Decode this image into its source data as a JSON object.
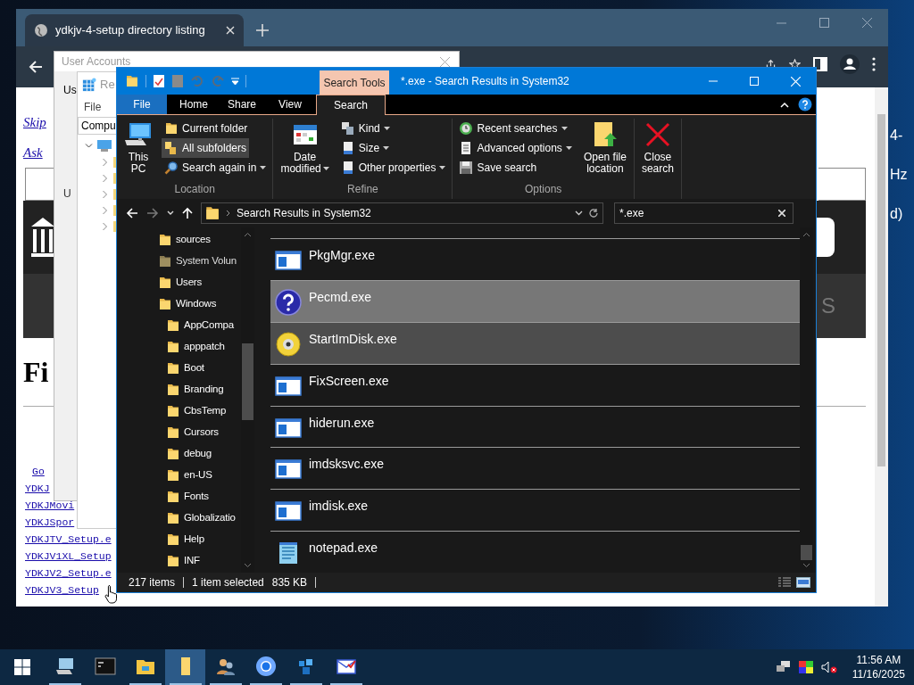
{
  "browser": {
    "tab_title": "ydkjv-4-setup directory listing",
    "page": {
      "skip_link": "Skip",
      "ask_link": "Ask",
      "banner_text": "S",
      "heading": "Fi",
      "links": [
        "Go",
        "YDKJ",
        "YDKJMovi",
        "YDKJSpor",
        "YDKJTV_Setup.e",
        "YDKJV1XL_Setup",
        "YDKJV2_Setup.e",
        "YDKJV3_Setup"
      ]
    }
  },
  "desktop_fragments": [
    "4-",
    "Hz",
    "d)"
  ],
  "user_accounts": {
    "title": "User Accounts",
    "tab": "Us",
    "label": "U"
  },
  "regedit": {
    "title": "Re",
    "menu": "File",
    "address": "Compu"
  },
  "explorer": {
    "contextual_tab": "Search Tools",
    "title": "*.exe - Search Results in System32",
    "tabs": [
      {
        "label": "File",
        "kind": "file",
        "selected": false
      },
      {
        "label": "Home",
        "kind": "tab",
        "selected": false
      },
      {
        "label": "Share",
        "kind": "tab",
        "selected": false
      },
      {
        "label": "View",
        "kind": "tab",
        "selected": false
      },
      {
        "label": "Search",
        "kind": "tab",
        "selected": true
      }
    ],
    "ribbon": [
      {
        "label": "Location",
        "items": [
          {
            "label": "This\nPC",
            "kind": "large",
            "dropdown": false,
            "selected": false
          },
          {
            "label": "Current folder",
            "kind": "small",
            "dropdown": false,
            "selected": false
          },
          {
            "label": "All subfolders",
            "kind": "small",
            "dropdown": false,
            "selected": true
          },
          {
            "label": "Search again in",
            "kind": "small",
            "dropdown": true,
            "selected": false
          }
        ]
      },
      {
        "label": "Refine",
        "items": [
          {
            "label": "Date\nmodified",
            "kind": "large",
            "dropdown": true,
            "selected": false
          },
          {
            "label": "Kind",
            "kind": "small",
            "dropdown": true,
            "selected": false
          },
          {
            "label": "Size",
            "kind": "small",
            "dropdown": true,
            "selected": false
          },
          {
            "label": "Other properties",
            "kind": "small",
            "dropdown": true,
            "selected": false
          }
        ]
      },
      {
        "label": "Options",
        "items": [
          {
            "label": "Recent searches",
            "kind": "small",
            "dropdown": true,
            "selected": false
          },
          {
            "label": "Advanced options",
            "kind": "small",
            "dropdown": true,
            "selected": false
          },
          {
            "label": "Save search",
            "kind": "small",
            "dropdown": false,
            "selected": false
          },
          {
            "label": "Open file\nlocation",
            "kind": "large",
            "dropdown": false,
            "selected": false
          }
        ]
      },
      {
        "items": [
          {
            "label": "Close\nsearch",
            "kind": "large",
            "dropdown": false,
            "selected": false
          }
        ]
      }
    ],
    "address": "Search Results in System32",
    "search": "*.exe",
    "nav": [
      {
        "label": "sources",
        "dimmed": false
      },
      {
        "label": "System Volun",
        "dimmed": true
      },
      {
        "label": "Users",
        "dimmed": false
      },
      {
        "label": "Windows",
        "dimmed": false,
        "children": [
          {
            "label": "AppCompa",
            "dimmed": false
          },
          {
            "label": "apppatch",
            "dimmed": false
          },
          {
            "label": "Boot",
            "dimmed": false
          },
          {
            "label": "Branding",
            "dimmed": false
          },
          {
            "label": "CbsTemp",
            "dimmed": false
          },
          {
            "label": "Cursors",
            "dimmed": false
          },
          {
            "label": "debug",
            "dimmed": false
          },
          {
            "label": "en-US",
            "dimmed": false
          },
          {
            "label": "Fonts",
            "dimmed": false
          },
          {
            "label": "Globalizatio",
            "dimmed": false
          },
          {
            "label": "Help",
            "dimmed": false
          },
          {
            "label": "INF",
            "dimmed": false
          }
        ]
      }
    ],
    "files": [
      {
        "name": "PkgMgr.exe",
        "kind": "app",
        "selected": false,
        "hovered": false
      },
      {
        "name": "Pecmd.exe",
        "kind": "help",
        "selected": true,
        "hovered": false
      },
      {
        "name": "StartImDisk.exe",
        "kind": "disc",
        "selected": false,
        "hovered": true
      },
      {
        "name": "FixScreen.exe",
        "kind": "app",
        "selected": false,
        "hovered": false
      },
      {
        "name": "hiderun.exe",
        "kind": "app",
        "selected": false,
        "hovered": false
      },
      {
        "name": "imdsksvc.exe",
        "kind": "app",
        "selected": false,
        "hovered": false
      },
      {
        "name": "imdisk.exe",
        "kind": "app",
        "selected": false,
        "hovered": false
      },
      {
        "name": "notepad.exe",
        "kind": "notepad",
        "selected": false,
        "hovered": false
      }
    ],
    "status": {
      "count": "217 items",
      "selection": "1 item selected",
      "size": "835 KB"
    }
  },
  "taskbar": {
    "apps": [
      {
        "kind": "computer",
        "running": true,
        "active": false
      },
      {
        "kind": "terminal",
        "running": false,
        "active": false
      },
      {
        "kind": "explorer",
        "running": true,
        "active": false
      },
      {
        "kind": "folder",
        "running": true,
        "active": true
      },
      {
        "kind": "users",
        "running": true,
        "active": false
      },
      {
        "kind": "browser",
        "running": true,
        "active": false
      },
      {
        "kind": "network",
        "running": true,
        "active": false
      },
      {
        "kind": "mail",
        "running": true,
        "active": false
      }
    ],
    "time": "11:56 AM",
    "date": "11/16/2025"
  }
}
